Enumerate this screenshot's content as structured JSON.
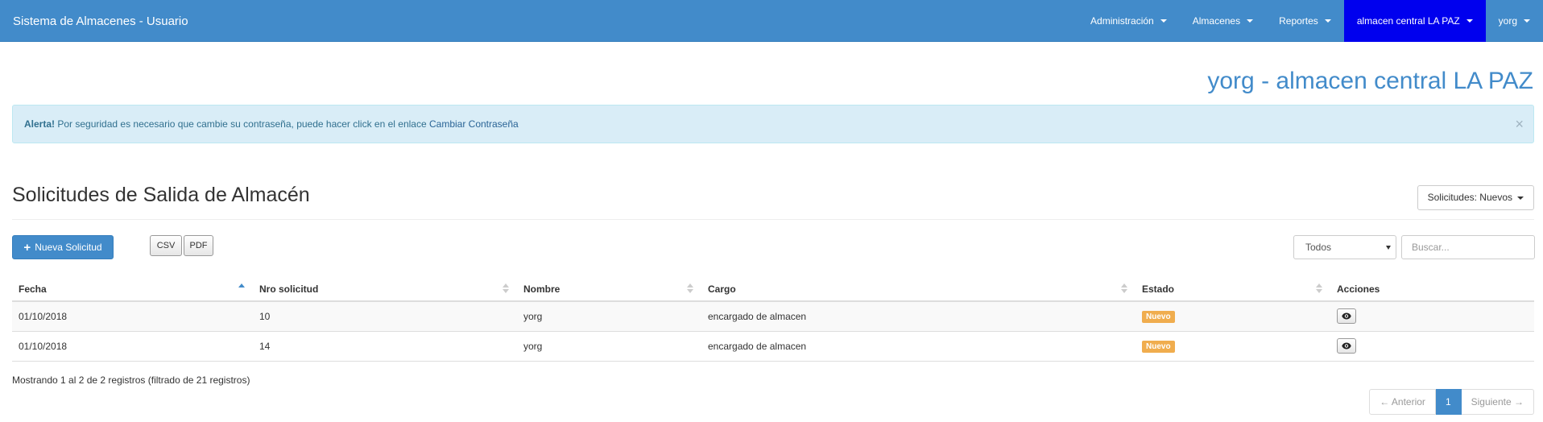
{
  "navbar": {
    "brand": "Sistema de Almacenes - Usuario",
    "items": [
      {
        "label": "Administración"
      },
      {
        "label": "Almacenes"
      },
      {
        "label": "Reportes"
      },
      {
        "label": "almacen central LA PAZ"
      },
      {
        "label": "yorg"
      }
    ]
  },
  "page": {
    "heading": "yorg - almacen central LA PAZ",
    "section_title": "Solicitudes de Salida de Almacén"
  },
  "alert": {
    "title": "Alerta!",
    "message": "Por seguridad es necesario que cambie su contraseña, puede hacer click en el enlace",
    "link": "Cambiar Contraseña",
    "close": "×"
  },
  "filter_button": {
    "label": "Solicitudes: Nuevos"
  },
  "toolbar": {
    "new_button": "Nueva Solicitud",
    "csv": "CSV",
    "pdf": "PDF",
    "select_value": "Todos",
    "search_placeholder": "Buscar..."
  },
  "table": {
    "columns": [
      "Fecha",
      "Nro solicitud",
      "Nombre",
      "Cargo",
      "Estado",
      "Acciones"
    ],
    "rows": [
      {
        "fecha": "01/10/2018",
        "nro": "10",
        "nombre": "yorg",
        "cargo": "encargado de almacen",
        "estado": "Nuevo"
      },
      {
        "fecha": "01/10/2018",
        "nro": "14",
        "nombre": "yorg",
        "cargo": "encargado de almacen",
        "estado": "Nuevo"
      }
    ]
  },
  "footer": {
    "info": "Mostrando 1 al 2 de 2 registros (filtrado de 21 registros)",
    "prev": "← Anterior",
    "page": "1",
    "next": "Siguiente →"
  },
  "colors": {
    "primary": "#428bca",
    "active_nav": "#0000ee",
    "badge": "#f0ad4e",
    "alert_bg": "#d9edf7"
  }
}
